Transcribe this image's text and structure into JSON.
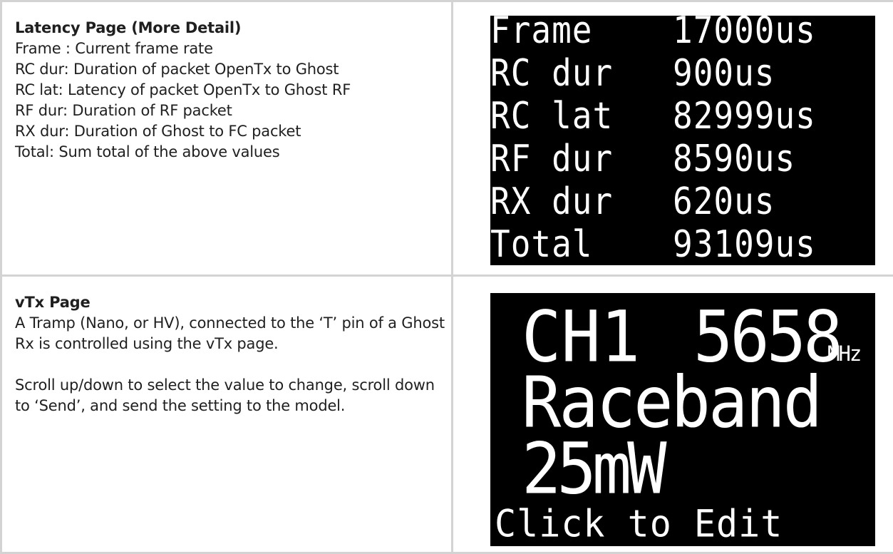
{
  "latency_section": {
    "heading": "Latency Page (More Detail)",
    "lines": [
      "Frame : Current frame rate",
      "RC dur: Duration of packet OpenTx to Ghost",
      "RC lat: Latency of packet OpenTx to Ghost RF",
      "RF dur: Duration of RF packet",
      "RX dur: Duration of Ghost to FC packet",
      "Total: Sum total of the above values"
    ],
    "screen": {
      "rows": [
        {
          "label": "Frame",
          "value": "17000us"
        },
        {
          "label": "RC dur",
          "value": "900us"
        },
        {
          "label": "RC lat",
          "value": "82999us"
        },
        {
          "label": "RF dur",
          "value": "8590us"
        },
        {
          "label": "RX dur",
          "value": "620us"
        },
        {
          "label": "Total",
          "value": "93109us"
        }
      ]
    }
  },
  "vtx_section": {
    "heading": "vTx Page",
    "paragraph1": "A Tramp (Nano, or HV), connected to the ‘T’ pin of a Ghost Rx is controlled using the vTx page.",
    "paragraph2": "Scroll up/down to select the value to change, scroll down to ‘Send’, and send the setting to the model.",
    "screen": {
      "channel": "CH1",
      "frequency": "5658",
      "unit": "MHz",
      "band": "Raceband",
      "power": "25mW",
      "action": "Click to Edit"
    }
  }
}
